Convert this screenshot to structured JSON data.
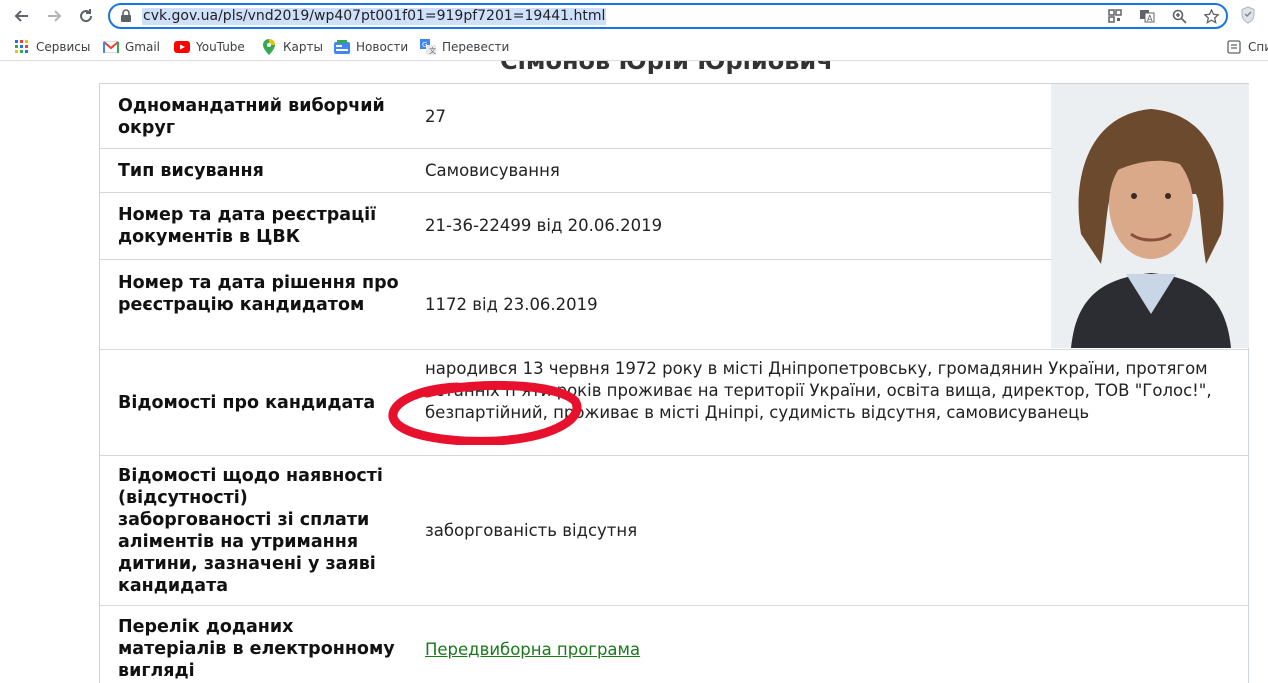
{
  "browser": {
    "url": "cvk.gov.ua/pls/vnd2019/wp407pt001f01=919pf7201=19441.html",
    "bookmarks": [
      {
        "label": "Сервисы",
        "icon": "apps-grid-icon"
      },
      {
        "label": "Gmail",
        "icon": "gmail-icon"
      },
      {
        "label": "YouTube",
        "icon": "youtube-icon"
      },
      {
        "label": "Карты",
        "icon": "maps-pin-icon"
      },
      {
        "label": "Новости",
        "icon": "news-icon"
      },
      {
        "label": "Перевести",
        "icon": "translate-icon"
      }
    ],
    "reading_list": "Спи"
  },
  "page": {
    "title_cut": "Сімонов Юрій Юрійович",
    "rows": [
      {
        "label": "Одномандатний виборчий округ",
        "value": "27"
      },
      {
        "label": "Тип висування",
        "value": "Самовисування"
      },
      {
        "label": "Номер та дата реєстрації документів в ЦВК",
        "value": "21-36-22499 від 20.06.2019"
      },
      {
        "label": "Номер та дата рішення про реєстрацію кандидатом",
        "value": "1172 від 23.06.2019"
      },
      {
        "label": "Відомості про кандидата",
        "value": "народився 13 червня 1972 року в місті Дніпропетровську, громадянин України, протягом останніх п’яти років проживає на території України, освіта вища, директор, ТОВ \"Голос!\", безпартійний, проживає в місті Дніпрі, судимість відсутня, самовисуванець"
      },
      {
        "label": "Відомості щодо наявності (відсутності) заборгованості зі сплати аліментів на утримання дитини, зазначені у заяві кандидата",
        "value": "заборгованість відсутня"
      },
      {
        "label": "Перелік доданих матеріалів в електронному вигляді",
        "value": "Передвиборна програма"
      }
    ]
  },
  "colors": {
    "omnibox_border": "#1a73e8",
    "link": "#1a7a1a",
    "annotation": "#e8112d"
  }
}
